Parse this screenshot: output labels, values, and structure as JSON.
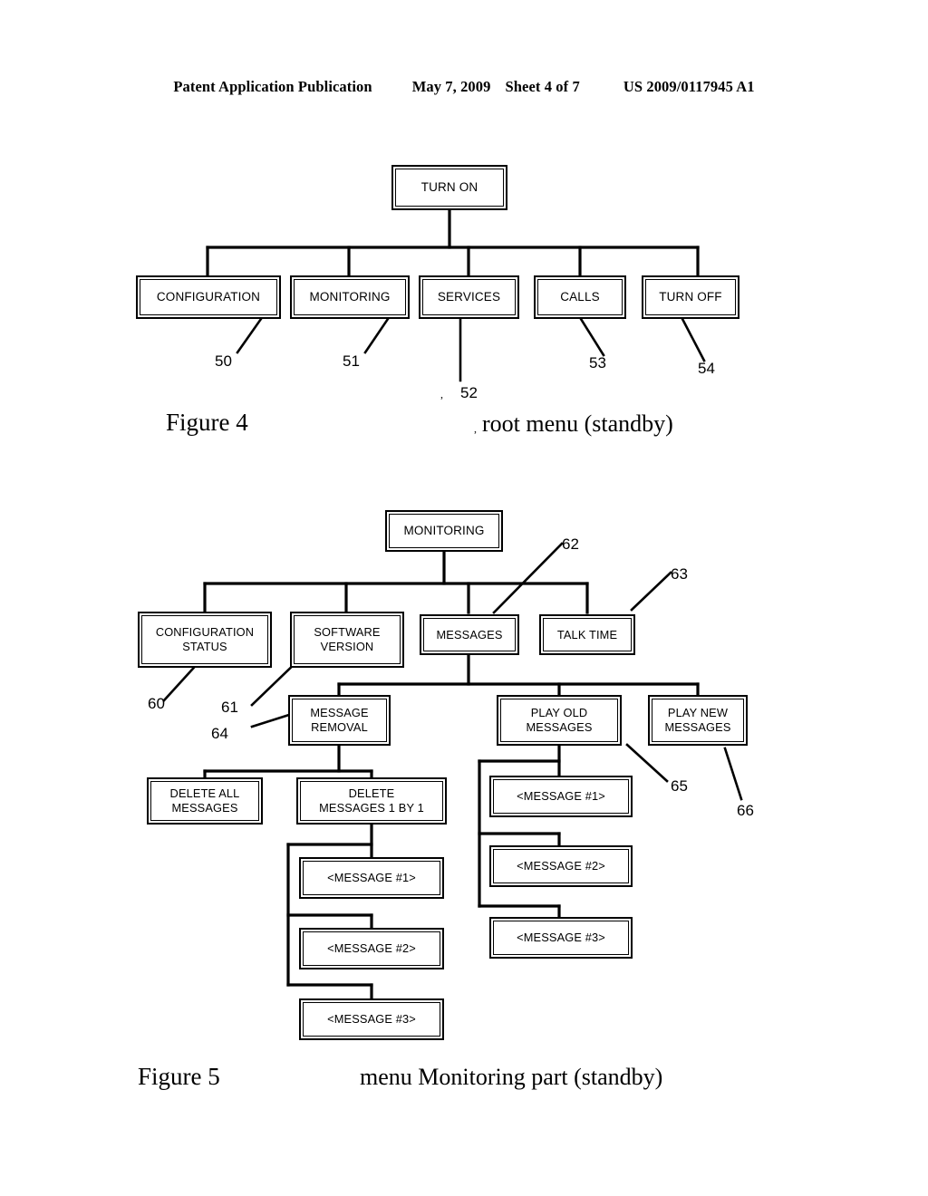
{
  "header": {
    "publication": "Patent Application Publication",
    "date": "May 7, 2009",
    "sheet": "Sheet 4 of 7",
    "patent_number": "US 2009/0117945 A1"
  },
  "figure4": {
    "caption": "Figure 4",
    "subtitle": "root menu (standby)",
    "root": {
      "label": "TURN ON"
    },
    "children": [
      {
        "label": "CONFIGURATION",
        "ref": "50"
      },
      {
        "label": "MONITORING",
        "ref": "51"
      },
      {
        "label": "SERVICES",
        "ref": "52"
      },
      {
        "label": "CALLS",
        "ref": "53"
      },
      {
        "label": "TURN OFF",
        "ref": "54"
      }
    ]
  },
  "figure5": {
    "caption": "Figure 5",
    "subtitle": "menu Monitoring part (standby)",
    "root": {
      "label": "MONITORING"
    },
    "level2": [
      {
        "label": "CONFIGURATION STATUS",
        "line1": "CONFIGURATION",
        "line2": "STATUS",
        "ref": "60"
      },
      {
        "label": "SOFTWARE VERSION",
        "line1": "SOFTWARE",
        "line2": "VERSION",
        "ref": "61"
      },
      {
        "label": "MESSAGES",
        "line1": "MESSAGES",
        "line2": "",
        "ref": "62"
      },
      {
        "label": "TALK TIME",
        "line1": "TALK TIME",
        "line2": "",
        "ref": "63"
      }
    ],
    "level3": [
      {
        "label": "MESSAGE REMOVAL",
        "line1": "MESSAGE",
        "line2": "REMOVAL",
        "ref": "64"
      },
      {
        "label": "PLAY OLD MESSAGES",
        "line1": "PLAY OLD",
        "line2": "MESSAGES",
        "ref": "65"
      },
      {
        "label": "PLAY NEW MESSAGES",
        "line1": "PLAY NEW",
        "line2": "MESSAGES",
        "ref": "66"
      }
    ],
    "level4": [
      {
        "label": "DELETE ALL MESSAGES",
        "line1": "DELETE ALL",
        "line2": "MESSAGES"
      },
      {
        "label": "DELETE MESSAGES 1 BY 1",
        "line1": "DELETE",
        "line2": "MESSAGES 1 BY 1"
      }
    ],
    "delete_chain": [
      {
        "label": "<MESSAGE #1>"
      },
      {
        "label": "<MESSAGE #2>"
      },
      {
        "label": "<MESSAGE #3>"
      }
    ],
    "play_chain": [
      {
        "label": "<MESSAGE #1>"
      },
      {
        "label": "<MESSAGE #2>"
      },
      {
        "label": "<MESSAGE #3>"
      }
    ]
  },
  "stray_marks": {
    "mark_52": ",",
    "mark_root": ","
  }
}
